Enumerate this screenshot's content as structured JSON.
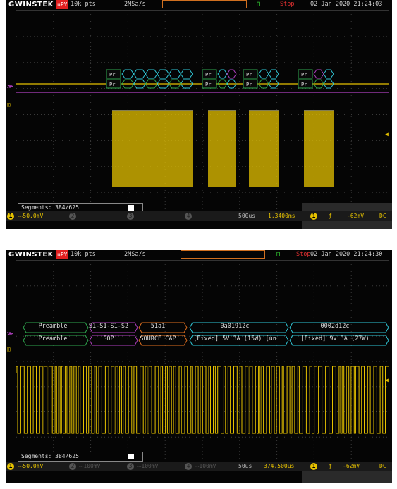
{
  "scope1": {
    "header": {
      "logo": "GWINSTEK",
      "mode": "uPY",
      "points": "10k pts",
      "rate": "2MSa/s",
      "status": "Stop",
      "datetime": "02 Jan 2020 21:24:03"
    },
    "decode_marker": "Pr",
    "footer": {
      "ch1_num": "1",
      "ch1_scale": "50.0mV",
      "ch2_num": "2",
      "ch3_num": "3",
      "ch4_num": "4",
      "timebase": "500us",
      "position": "1.3400ms",
      "trig_ch": "1",
      "trig_slope": "ƒ",
      "trig_level": "-62mV",
      "coupling": "DC"
    },
    "segments": "Segments: 384/625"
  },
  "scope2": {
    "header": {
      "logo": "GWINSTEK",
      "mode": "uPY",
      "points": "10k pts",
      "rate": "2MSa/s",
      "status": "Stop",
      "datetime": "02 Jan 2020 21:24:30"
    },
    "decode_row1": [
      {
        "text": "Preamble"
      },
      {
        "text": "S1-S1-S1-S2"
      },
      {
        "text": "51a1"
      },
      {
        "text": "0a01912c"
      },
      {
        "text": "0002d12c"
      }
    ],
    "decode_row2": [
      {
        "text": "Preamble"
      },
      {
        "text": "SOP"
      },
      {
        "text": "SOURCE CAP"
      },
      {
        "text": "[Fixed] 5V 3A (15W) [un"
      },
      {
        "text": "[Fixed] 9V 3A (27W)"
      }
    ],
    "footer": {
      "ch1_num": "1",
      "ch1_scale": "50.0mV",
      "ch2_num": "2",
      "ch2_scale": "100mV",
      "ch3_num": "3",
      "ch3_scale": "100mV",
      "ch4_num": "4",
      "ch4_scale": "100mV",
      "timebase": "50us",
      "position": "374.500us",
      "trig_ch": "1",
      "trig_slope": "ƒ",
      "trig_level": "-62mV",
      "coupling": "DC"
    },
    "segments": "Segments: 384/625"
  },
  "colors": {
    "ch1": "#e6c200",
    "decode_green": "#2fa84f",
    "decode_purple": "#b040c0",
    "decode_orange": "#e07020",
    "decode_cyan": "#30c8d8",
    "stop": "#e03030"
  }
}
